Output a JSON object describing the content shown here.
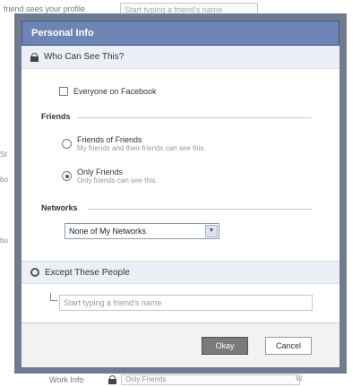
{
  "background": {
    "top_text": "friend sees your profile",
    "top_input_placeholder": "Start typing a friend's name",
    "left_fragments": [
      "St",
      "bo",
      "bu"
    ],
    "bottom_label": "Work Info",
    "bottom_select": "Only Friends",
    "bottom_right": "W"
  },
  "dialog": {
    "title": "Personal Info",
    "who_heading": "Who Can See This?",
    "everyone_label": "Everyone on Facebook",
    "friends_heading": "Friends",
    "options": [
      {
        "label": "Friends of Friends",
        "desc": "My friends and their friends can see this."
      },
      {
        "label": "Only Friends",
        "desc": "Only friends can see this."
      }
    ],
    "networks_heading": "Networks",
    "networks_select": "None of My Networks",
    "except_heading": "Except These People",
    "except_placeholder": "Start typing a friend's name",
    "okay_label": "Okay",
    "cancel_label": "Cancel"
  }
}
